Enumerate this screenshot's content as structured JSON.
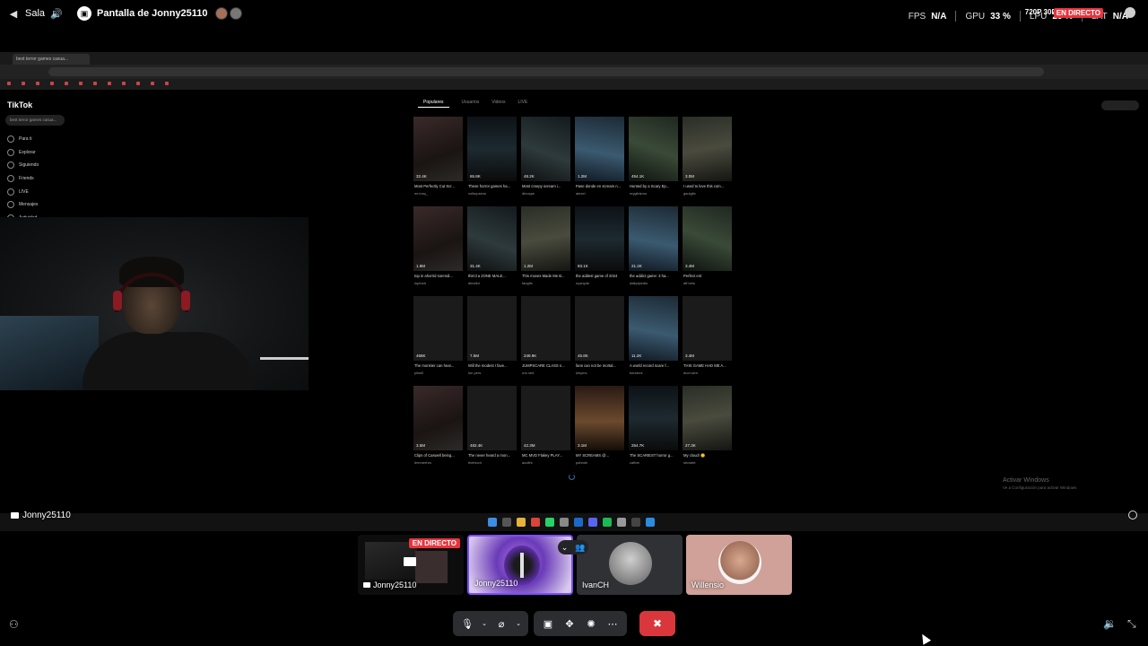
{
  "topbar": {
    "channel": "Sala",
    "screen_title": "Pantalla de Jonny25110",
    "fps_label": "FPS",
    "fps_value": "N/A",
    "gpu_label": "GPU",
    "gpu_value": "33 %",
    "lpu_label": "LPU",
    "lpu_value": "25 %",
    "lat_label": "LAT",
    "lat_value": "N/A",
    "resolution": "720P 30FPS",
    "live_badge": "EN DIRECTO"
  },
  "stream": {
    "tiktok_brand": "TikTok",
    "tiktok_search": "best terror games casua...",
    "tiktok_nav": [
      "Para ti",
      "Explorar",
      "Siguiendo",
      "Friends",
      "LIVE",
      "Mensajes",
      "Actividad"
    ],
    "tiktok_tabs": [
      "Populares",
      "Usuarios",
      "Videos",
      "LIVE"
    ],
    "videos": [
      {
        "views": "32.4K",
        "desc": "Most Perfectly Cut Scr...",
        "author": "mr.imry_"
      },
      {
        "views": "65.8K",
        "desc": "These horror games ha...",
        "author": "volkupsimo"
      },
      {
        "views": "48.2K",
        "desc": "Most creepy scream i...",
        "author": "dinospe"
      },
      {
        "views": "1.2M",
        "desc": "Pase donde en scream n...",
        "author": "alexel"
      },
      {
        "views": "454.1K",
        "desc": "Hunted by a Scary Ep...",
        "author": "myglinkmo"
      },
      {
        "views": "3.0M",
        "desc": "I used to love this com...",
        "author": "gaulgfix"
      },
      {
        "views": "1.9M",
        "desc": "top in ahorrid sorendi...",
        "author": "lopfunri"
      },
      {
        "views": "31.4K",
        "desc": "this'd a 2ONE MALE...",
        "author": "dimelid"
      },
      {
        "views": "1.2M",
        "desc": "This moves Made Me B...",
        "author": "fangfis"
      },
      {
        "views": "83.1K",
        "desc": "the addest game of 2024",
        "author": "nyanyde"
      },
      {
        "views": "21.2K",
        "desc": "the addict game: 3 ha...",
        "author": "dallydpedio"
      },
      {
        "views": "3.4M",
        "desc": "Perfect ent",
        "author": "aff.beis"
      },
      {
        "views": "468K",
        "desc": "The monster can hear...",
        "author": "pilsell"
      },
      {
        "views": "7.5M",
        "desc": "Will the modest I fave...",
        "author": "lon pers"
      },
      {
        "views": "249.9K",
        "desc": "JUMPSCARE CLASS n...",
        "author": "n/a ned"
      },
      {
        "views": "45.8K",
        "desc": "fans can not be mortal...",
        "author": "kinyms"
      },
      {
        "views": "11.2K",
        "desc": "A world record scare f...",
        "author": "futuremi"
      },
      {
        "views": "3.4M",
        "desc": "THIS GAME HAD ME A...",
        "author": "duct wint"
      },
      {
        "views": "3.5M",
        "desc": "Clips of Caswell being...",
        "author": "lemmerhrs"
      },
      {
        "views": "482.4K",
        "desc": "The never heard a mon...",
        "author": "thebroot"
      },
      {
        "views": "42.3M",
        "desc": "MC MVD Flakey PLAY...",
        "author": "aculthi"
      },
      {
        "views": "3.1M",
        "desc": "MY SCREAMS @...",
        "author": "pahndn"
      },
      {
        "views": "254.7K",
        "desc": "The SCARIEST horror g...",
        "author": "caftdn"
      },
      {
        "views": "27.3K",
        "desc": "My cloud! 🙂",
        "author": "showtie"
      }
    ],
    "activate_windows": "Activar Windows",
    "activate_windows_sub": "Ve a Configuración para activar Windows",
    "streamer_name": "Jonny25110"
  },
  "participants": [
    {
      "name": "Jonny25110",
      "screen": true,
      "live": "EN DIRECTO"
    },
    {
      "name": "Jonny25110",
      "screen": false
    },
    {
      "name": "IvanCH",
      "screen": false
    },
    {
      "name": "Willensio",
      "screen": false
    }
  ],
  "colors": {
    "live_red": "#e8343d",
    "leave_red": "#da373c",
    "speaking_border": "#7c4dff"
  }
}
